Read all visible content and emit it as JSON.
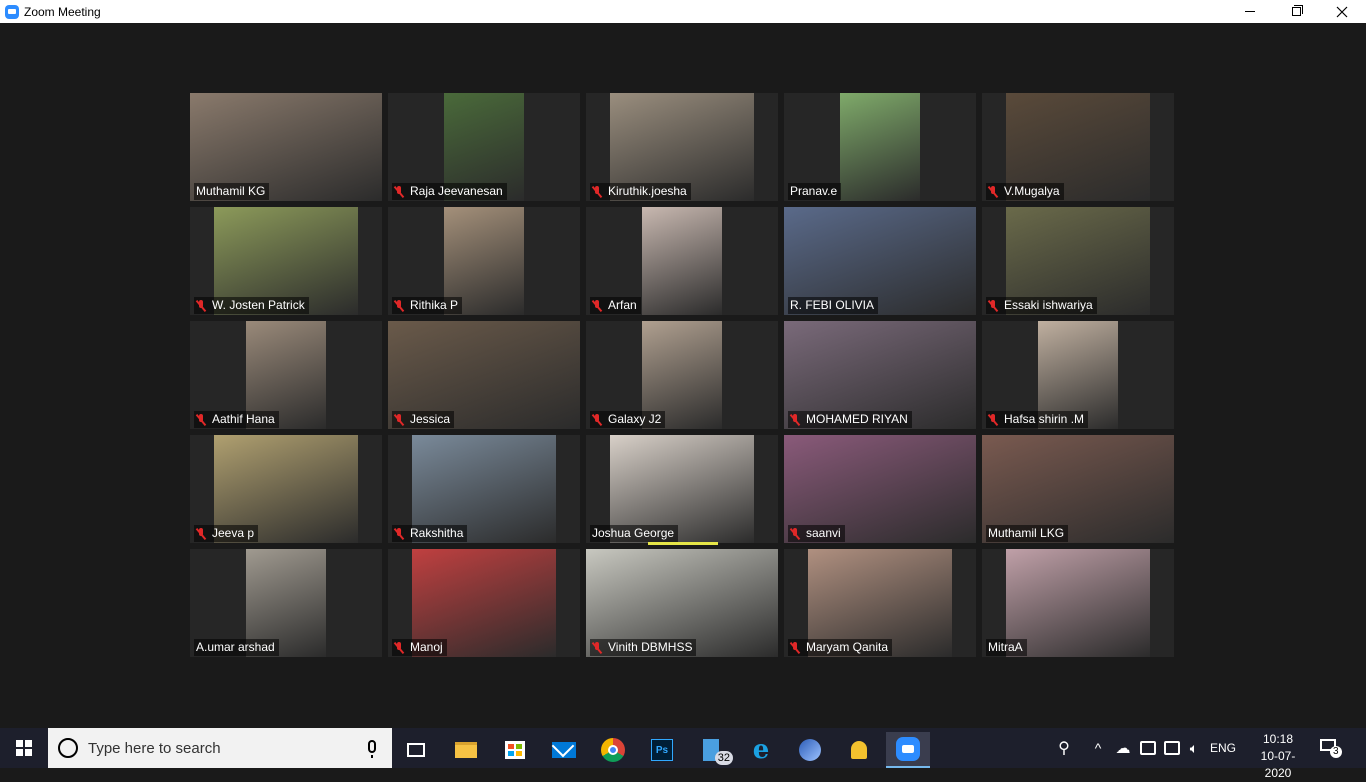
{
  "window": {
    "title": "Zoom Meeting"
  },
  "participants": [
    {
      "name": "Muthamil KG",
      "muted": false,
      "active": false,
      "bg": "#8a7a6c"
    },
    {
      "name": "Raja Jeevanesan",
      "muted": true,
      "active": false,
      "bg": "#4a6a3a"
    },
    {
      "name": "Kiruthik.joesha",
      "muted": true,
      "active": false,
      "bg": "#9a8e7e"
    },
    {
      "name": "Pranav.e",
      "muted": false,
      "active": false,
      "bg": "#7faa6a"
    },
    {
      "name": "V.Mugalya",
      "muted": true,
      "active": false,
      "bg": "#5a4a3a"
    },
    {
      "name": "W. Josten Patrick",
      "muted": true,
      "active": false,
      "bg": "#8c9a5a"
    },
    {
      "name": "Rithika P",
      "muted": true,
      "active": false,
      "bg": "#a4907a"
    },
    {
      "name": "Arfan",
      "muted": true,
      "active": false,
      "bg": "#c8b8b0"
    },
    {
      "name": "R. FEBI  OLIVIA",
      "muted": false,
      "active": true,
      "bg": "#5a6a8a"
    },
    {
      "name": "Essaki ishwariya",
      "muted": true,
      "active": false,
      "bg": "#6a6a4a"
    },
    {
      "name": "Aathif  Hana",
      "muted": true,
      "active": false,
      "bg": "#9a8a7a"
    },
    {
      "name": "Jessica",
      "muted": true,
      "active": false,
      "bg": "#6a5a4a"
    },
    {
      "name": "Galaxy J2",
      "muted": true,
      "active": false,
      "bg": "#b0a090"
    },
    {
      "name": "MOHAMED RIYAN",
      "muted": true,
      "active": false,
      "bg": "#7a6a7a"
    },
    {
      "name": "Hafsa shirin .M",
      "muted": true,
      "active": false,
      "bg": "#c0b0a0"
    },
    {
      "name": "Jeeva p",
      "muted": true,
      "active": false,
      "bg": "#b0a070"
    },
    {
      "name": "Rakshitha",
      "muted": true,
      "active": false,
      "bg": "#7a8a9a"
    },
    {
      "name": "Joshua George",
      "muted": false,
      "active": false,
      "bg": "#d8d0c8"
    },
    {
      "name": "saanvi",
      "muted": true,
      "active": false,
      "bg": "#8a5a7a"
    },
    {
      "name": "Muthamil LKG",
      "muted": false,
      "active": false,
      "bg": "#7a5a50"
    },
    {
      "name": "A.umar arshad",
      "muted": false,
      "active": false,
      "bg": "#a09a90"
    },
    {
      "name": "Manoj",
      "muted": true,
      "active": false,
      "bg": "#c04040"
    },
    {
      "name": "Vinith DBMHSS",
      "muted": true,
      "active": false,
      "bg": "#c8c8c0"
    },
    {
      "name": "Maryam Qanita",
      "muted": true,
      "active": false,
      "bg": "#b09080"
    },
    {
      "name": "MitraA",
      "muted": false,
      "active": false,
      "bg": "#c0a0a8"
    }
  ],
  "taskbar": {
    "search_placeholder": "Type here to search",
    "photoshop_label": "Ps",
    "calc_badge": "32",
    "language": "ENG",
    "time": "10:18",
    "date": "10-07-2020",
    "notification_count": "3"
  },
  "colors": {
    "accent": "#2d8cff",
    "active_speaker": "#e6e648",
    "muted": "#e02828"
  }
}
